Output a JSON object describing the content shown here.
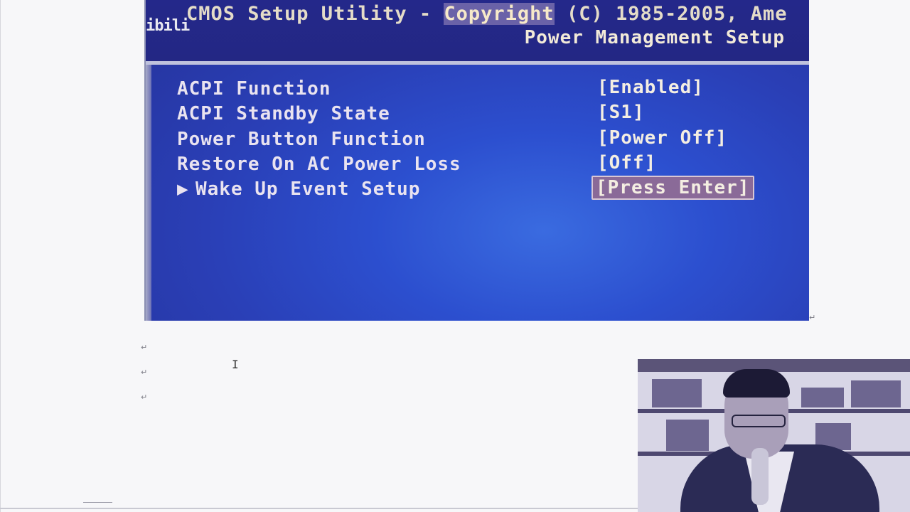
{
  "bios": {
    "copyright_prefix": "CMOS Setup Utility - ",
    "copyright_highlight": "Copyright",
    "copyright_suffix": " (C) 1985-2005, Ame",
    "subtitle": "Power Management Setup",
    "watermark": "ibili",
    "items": [
      {
        "label": "ACPI Function",
        "value": "[Enabled]",
        "submenu": false,
        "selected": false
      },
      {
        "label": "ACPI Standby State",
        "value": "[S1]",
        "submenu": false,
        "selected": false
      },
      {
        "label": "Power Button Function",
        "value": "[Power Off]",
        "submenu": false,
        "selected": false
      },
      {
        "label": "Restore On AC Power Loss",
        "value": "[Off]",
        "submenu": false,
        "selected": false
      },
      {
        "label": "Wake Up Event Setup",
        "value": "[Press Enter]",
        "submenu": true,
        "selected": true
      }
    ],
    "submenu_arrow": "▶"
  },
  "document": {
    "paragraph_mark": "↵",
    "cursor_glyph": "I"
  },
  "colors": {
    "bios_background": "#2a3fb6",
    "bios_header": "#24288a",
    "selection": "#8a6a98"
  }
}
